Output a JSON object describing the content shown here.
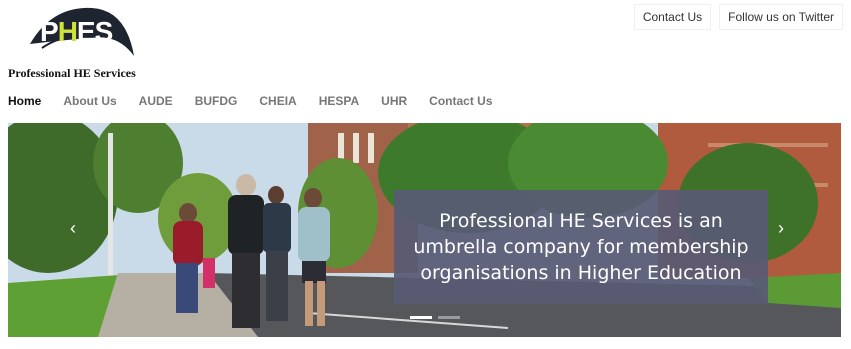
{
  "logo": {
    "text": "PHES",
    "subtitle": "Professional HE Services"
  },
  "top_links": [
    "Contact Us",
    "Follow us on Twitter"
  ],
  "nav": {
    "items": [
      "Home",
      "About Us",
      "AUDE",
      "BUFDG",
      "CHEIA",
      "HESPA",
      "UHR",
      "Contact Us"
    ],
    "active_index": 0
  },
  "hero": {
    "caption": "Professional HE Services is an\numbrella company for membership\norganisations in Higher Education",
    "slides_count": 2,
    "active_slide": 0
  },
  "colors": {
    "caption_bg": "#585a73",
    "logo_accent": "#cfe23a",
    "logo_dark": "#1e2430"
  },
  "icons": [
    "chevron-left-icon",
    "chevron-right-icon"
  ]
}
